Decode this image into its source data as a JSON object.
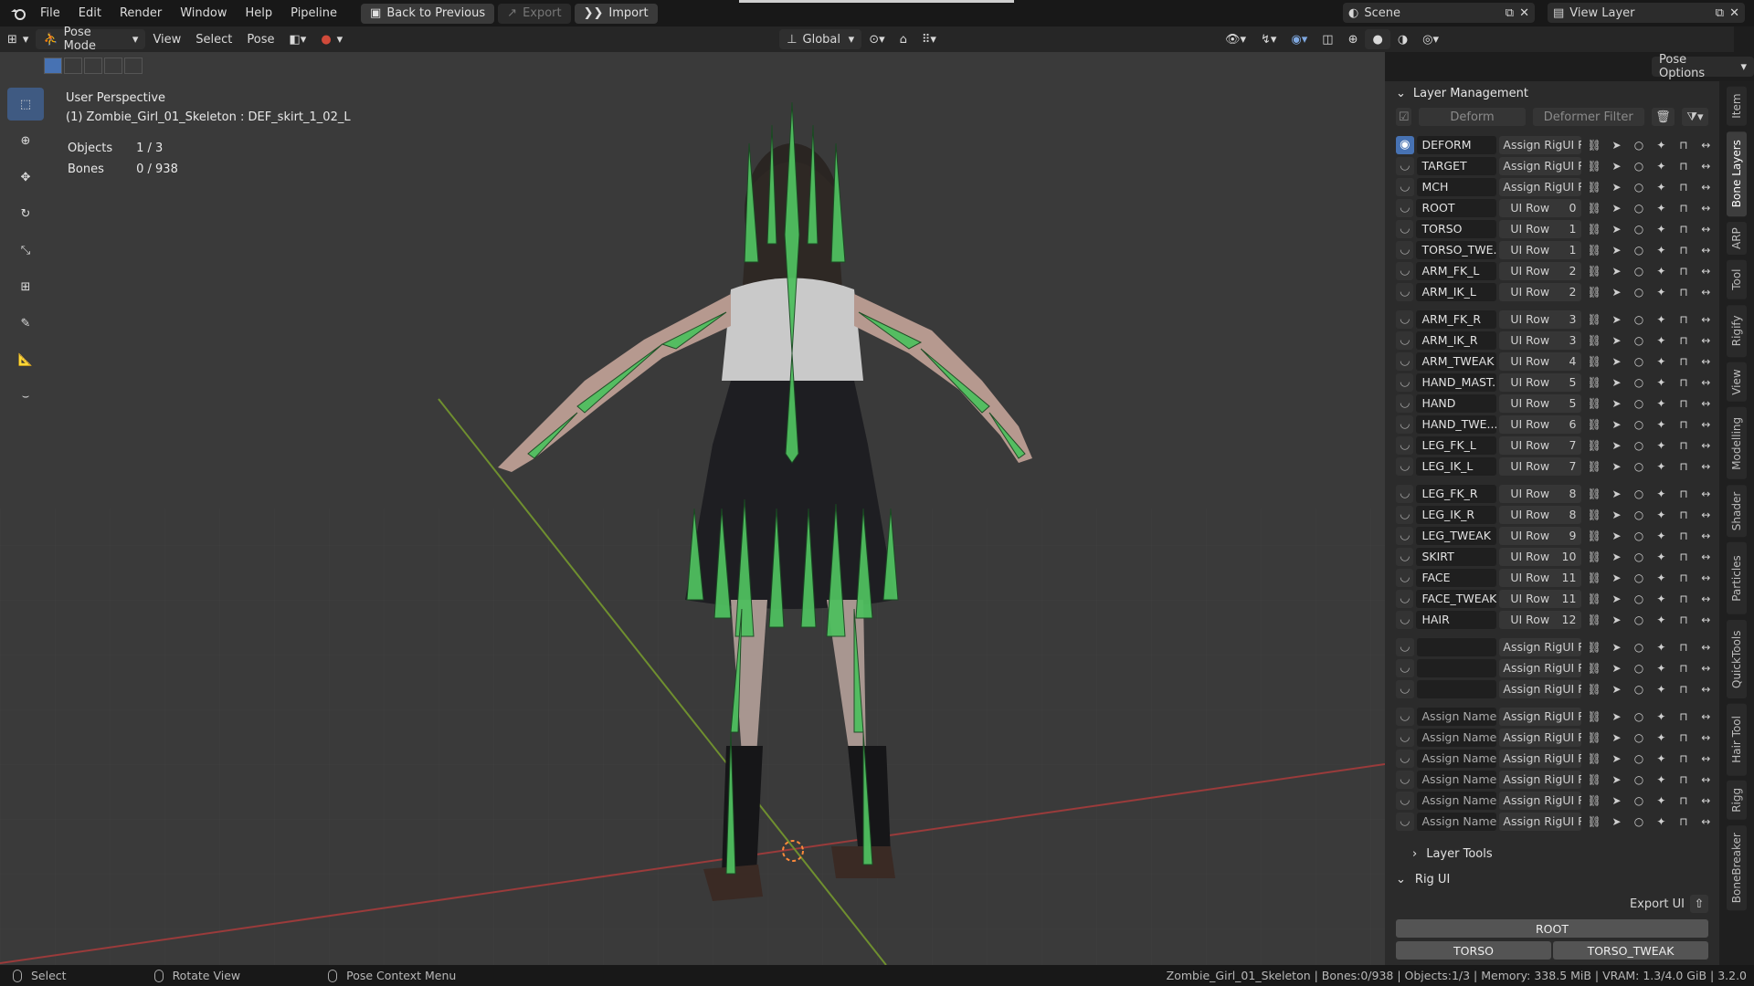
{
  "topbar": {
    "menu": [
      "File",
      "Edit",
      "Render",
      "Window",
      "Help",
      "Pipeline"
    ],
    "back_btn": "Back to Previous",
    "export_btn": "Export",
    "import_btn": "Import",
    "scene": "Scene",
    "view_layer": "View Layer"
  },
  "header": {
    "mode": "Pose Mode",
    "menus": [
      "View",
      "Select",
      "Pose"
    ],
    "transform": "Global",
    "pose_options": "Pose Options"
  },
  "viewport": {
    "perspective": "User Perspective",
    "active": "(1) Zombie_Girl_01_Skeleton : DEF_skirt_1_02_L",
    "objects_label": "Objects",
    "objects_value": "1 / 3",
    "bones_label": "Bones",
    "bones_value": "0 / 938"
  },
  "panel": {
    "title": "Layer Management",
    "deform_btn": "Deform",
    "deformer_filter": "Deformer Filter",
    "layers": [
      {
        "name": "DEFORM",
        "row": "Assign RigUI R...",
        "num": "",
        "visible": true
      },
      {
        "name": "TARGET",
        "row": "Assign RigUI R...",
        "num": ""
      },
      {
        "name": "MCH",
        "row": "Assign RigUI R...",
        "num": ""
      },
      {
        "name": "ROOT",
        "row": "UI Row",
        "num": "0"
      },
      {
        "name": "TORSO",
        "row": "UI Row",
        "num": "1"
      },
      {
        "name": "TORSO_TWE...",
        "row": "UI Row",
        "num": "1"
      },
      {
        "name": "ARM_FK_L",
        "row": "UI Row",
        "num": "2"
      },
      {
        "name": "ARM_IK_L",
        "row": "UI Row",
        "num": "2"
      },
      {
        "name": "ARM_FK_R",
        "row": "UI Row",
        "num": "3"
      },
      {
        "name": "ARM_IK_R",
        "row": "UI Row",
        "num": "3"
      },
      {
        "name": "ARM_TWEAK",
        "row": "UI Row",
        "num": "4"
      },
      {
        "name": "HAND_MAST...",
        "row": "UI Row",
        "num": "5"
      },
      {
        "name": "HAND",
        "row": "UI Row",
        "num": "5"
      },
      {
        "name": "HAND_TWE...",
        "row": "UI Row",
        "num": "6"
      },
      {
        "name": "LEG_FK_L",
        "row": "UI Row",
        "num": "7"
      },
      {
        "name": "LEG_IK_L",
        "row": "UI Row",
        "num": "7"
      },
      {
        "name": "LEG_FK_R",
        "row": "UI Row",
        "num": "8"
      },
      {
        "name": "LEG_IK_R",
        "row": "UI Row",
        "num": "8"
      },
      {
        "name": "LEG_TWEAK",
        "row": "UI Row",
        "num": "9"
      },
      {
        "name": "SKIRT",
        "row": "UI Row",
        "num": "10"
      },
      {
        "name": "FACE",
        "row": "UI Row",
        "num": "11"
      },
      {
        "name": "FACE_TWEAK",
        "row": "UI Row",
        "num": "11"
      },
      {
        "name": "HAIR",
        "row": "UI Row",
        "num": "12"
      },
      {
        "name": "",
        "row": "Assign RigUI R...",
        "num": ""
      },
      {
        "name": "",
        "row": "Assign RigUI R...",
        "num": ""
      },
      {
        "name": "",
        "row": "Assign RigUI R...",
        "num": ""
      },
      {
        "name": "Assign Name",
        "row": "Assign RigUI R...",
        "num": ""
      },
      {
        "name": "Assign Name",
        "row": "Assign RigUI R...",
        "num": ""
      },
      {
        "name": "Assign Name",
        "row": "Assign RigUI R...",
        "num": ""
      },
      {
        "name": "Assign Name",
        "row": "Assign RigUI R...",
        "num": ""
      },
      {
        "name": "Assign Name",
        "row": "Assign RigUI R...",
        "num": ""
      },
      {
        "name": "Assign Name",
        "row": "Assign RigUI R...",
        "num": ""
      }
    ],
    "layer_tools": "Layer Tools",
    "rig_ui": "Rig UI",
    "export_ui": "Export UI",
    "root_btn": "ROOT",
    "torso_btn": "TORSO",
    "torso_tweak_btn": "TORSO_TWEAK"
  },
  "tabs": [
    "Item",
    "Bone Layers",
    "ARP",
    "Tool",
    "Rigify",
    "View",
    "Modelling",
    "Shader",
    "Particles",
    "QuickTools",
    "Hair Tool",
    "Rigg",
    "BoneBreaker"
  ],
  "status": {
    "select": "Select",
    "rotate": "Rotate View",
    "context": "Pose Context Menu",
    "info": "Zombie_Girl_01_Skeleton | Bones:0/938 | Objects:1/3 | Memory: 338.5 MiB | VRAM: 1.3/4.0 GiB | 3.2.0"
  }
}
